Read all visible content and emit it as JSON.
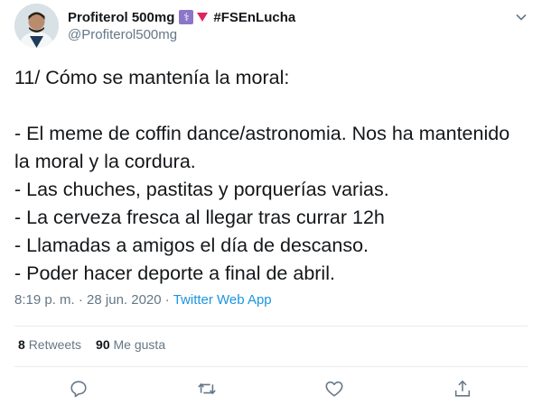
{
  "tweet": {
    "display_name": "Profiterol 500mg",
    "hashtag": "#FSEnLucha",
    "handle": "@Profiterol500mg",
    "body": "11/ Cómo se mantenía la moral:\n\n- El meme de coffin dance/astronomia. Nos ha mantenido la moral y la cordura.\n- Las chuches, pastitas y porquerías varias.\n- La cerveza fresca al llegar tras currar 12h\n- Llamadas a amigos el día de descanso.\n- Poder hacer deporte a final de abril.",
    "time": "8:19 p. m.",
    "date": "28 jun. 2020",
    "separator": "·",
    "app": "Twitter Web App",
    "retweets_count": "8",
    "retweets_label": "Retweets",
    "likes_count": "90",
    "likes_label": "Me gusta"
  },
  "icons": {
    "badge": "caduceus-icon",
    "flag": "red-triangle-icon",
    "menu": "chevron-down-icon",
    "reply": "reply-icon",
    "retweet": "retweet-icon",
    "like": "heart-icon",
    "share": "share-icon"
  },
  "colors": {
    "text": "#14171a",
    "secondary": "#657786",
    "link": "#1b95e0",
    "badge": "#8b76c9",
    "triangle": "#e0245e"
  }
}
